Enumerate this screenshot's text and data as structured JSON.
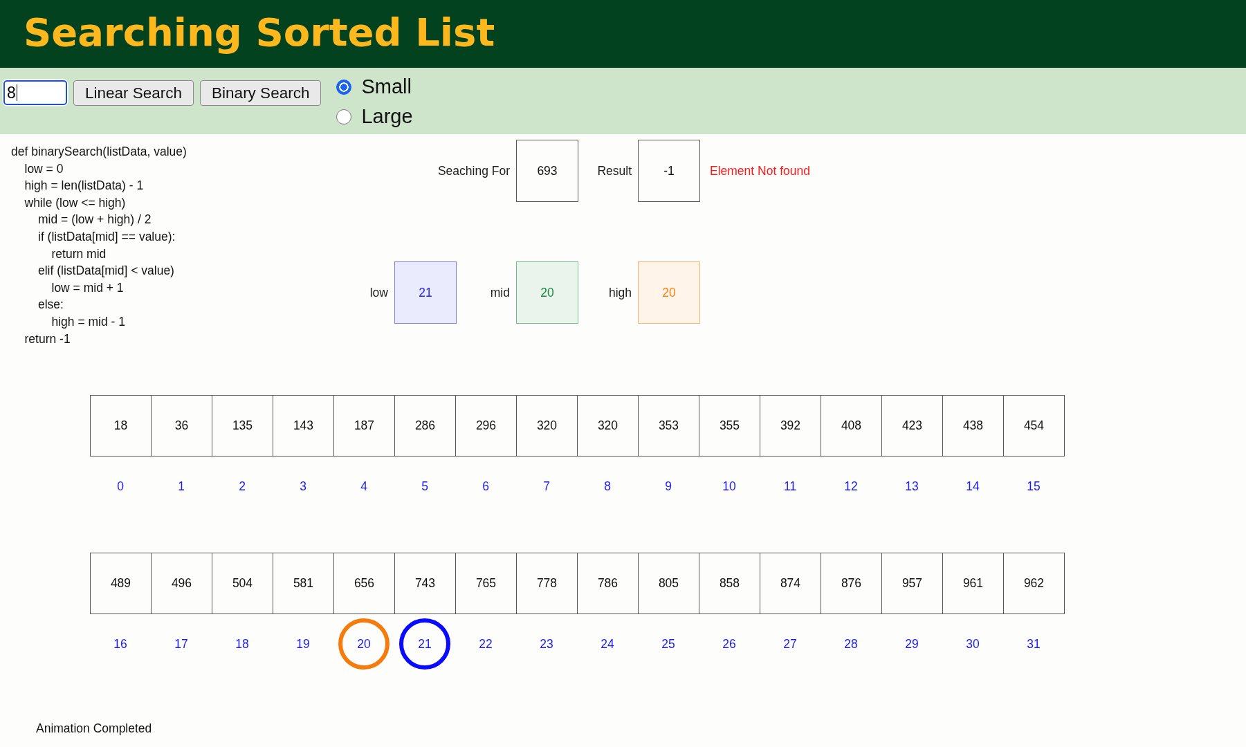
{
  "header": {
    "title": "Searching Sorted List"
  },
  "controls": {
    "search_input": {
      "value": "8"
    },
    "buttons": [
      "Linear Search",
      "Binary Search"
    ],
    "size_options": [
      {
        "label": "Small",
        "selected": true
      },
      {
        "label": "Large",
        "selected": false
      }
    ]
  },
  "code": [
    {
      "text": "def binarySearch(listData, value)",
      "children": [
        {
          "text": "low = 0"
        },
        {
          "text": "high = len(listData) - 1"
        },
        {
          "text": "while (low <= high)",
          "children": [
            {
              "text": "mid = (low + high) / 2"
            },
            {
              "text": "if (listData[mid] == value):",
              "children": [
                {
                  "text": "return mid"
                }
              ]
            },
            {
              "text": "elif (listData[mid] < value)",
              "children": [
                {
                  "text": "low = mid + 1"
                }
              ]
            },
            {
              "text": "else:",
              "children": [
                {
                  "text": "high = mid - 1"
                }
              ]
            }
          ]
        },
        {
          "text": "return -1"
        }
      ]
    }
  ],
  "search": {
    "label": "Seaching For",
    "value": "693"
  },
  "result": {
    "label": "Result",
    "value": "-1",
    "message": "Element Not found"
  },
  "pointers": [
    {
      "label": "low",
      "value": "21",
      "color": "#2424f5"
    },
    {
      "label": "mid",
      "value": "20",
      "color": "#168a3c"
    },
    {
      "label": "high",
      "value": "20",
      "color": "#f98110"
    }
  ],
  "array_rows": [
    {
      "cells": [
        {
          "value": "18",
          "index": "0",
          "circled": false
        },
        {
          "value": "36",
          "index": "1",
          "circled": false
        },
        {
          "value": "135",
          "index": "2",
          "circled": false
        },
        {
          "value": "143",
          "index": "3",
          "circled": false
        },
        {
          "value": "187",
          "index": "4",
          "circled": false
        },
        {
          "value": "286",
          "index": "5",
          "circled": false
        },
        {
          "value": "296",
          "index": "6",
          "circled": false
        },
        {
          "value": "320",
          "index": "7",
          "circled": false
        },
        {
          "value": "320",
          "index": "8",
          "circled": false
        },
        {
          "value": "353",
          "index": "9",
          "circled": false
        },
        {
          "value": "355",
          "index": "10",
          "circled": false
        },
        {
          "value": "392",
          "index": "11",
          "circled": false
        },
        {
          "value": "408",
          "index": "12",
          "circled": false
        },
        {
          "value": "423",
          "index": "13",
          "circled": false
        },
        {
          "value": "438",
          "index": "14",
          "circled": false
        },
        {
          "value": "454",
          "index": "15",
          "circled": false
        }
      ]
    },
    {
      "cells": [
        {
          "value": "489",
          "index": "16",
          "circled": false
        },
        {
          "value": "496",
          "index": "17",
          "circled": false
        },
        {
          "value": "504",
          "index": "18",
          "circled": false
        },
        {
          "value": "581",
          "index": "19",
          "circled": false
        },
        {
          "value": "656",
          "index": "20",
          "circled": true,
          "color": "#f57c0c"
        },
        {
          "value": "743",
          "index": "21",
          "circled": true,
          "color": "#0a0aff"
        },
        {
          "value": "765",
          "index": "22",
          "circled": false
        },
        {
          "value": "778",
          "index": "23",
          "circled": false
        },
        {
          "value": "786",
          "index": "24",
          "circled": false
        },
        {
          "value": "805",
          "index": "25",
          "circled": false
        },
        {
          "value": "858",
          "index": "26",
          "circled": false
        },
        {
          "value": "874",
          "index": "27",
          "circled": false
        },
        {
          "value": "876",
          "index": "28",
          "circled": false
        },
        {
          "value": "957",
          "index": "29",
          "circled": false
        },
        {
          "value": "961",
          "index": "30",
          "circled": false
        },
        {
          "value": "962",
          "index": "31",
          "circled": false
        }
      ]
    }
  ],
  "status": "Animation Completed"
}
